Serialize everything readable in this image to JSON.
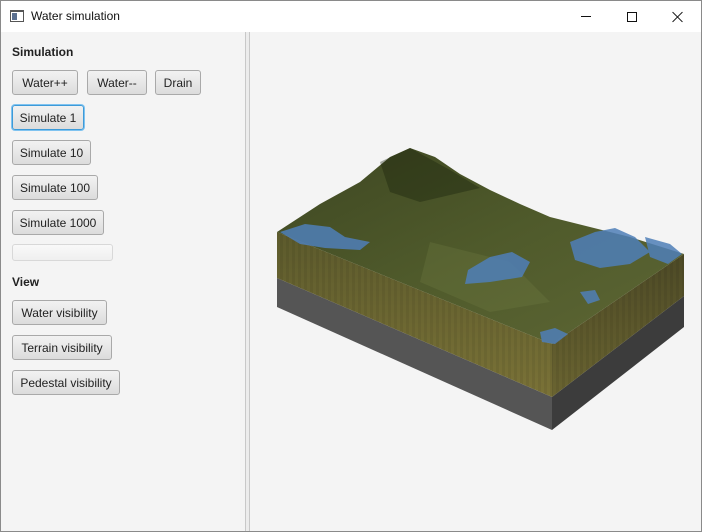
{
  "window": {
    "title": "Water simulation",
    "icon": "app-window-icon",
    "controls": {
      "minimize": "minimize-icon",
      "maximize": "maximize-icon",
      "close": "close-icon"
    }
  },
  "simulation": {
    "heading": "Simulation",
    "water_plus": "Water++",
    "water_minus": "Water--",
    "drain": "Drain",
    "simulate_1": "Simulate 1",
    "simulate_10": "Simulate 10",
    "simulate_100": "Simulate 100",
    "simulate_1000": "Simulate 1000",
    "progress": 0
  },
  "view": {
    "heading": "View",
    "water_visibility": "Water visibility",
    "terrain_visibility": "Terrain visibility",
    "pedestal_visibility": "Pedestal visibility"
  },
  "colors": {
    "terrain_top": "#4a5329",
    "terrain_side": "#6b6a33",
    "water": "#4f7fb8",
    "pedestal": "#4a4a4a",
    "focus_accent": "#3d9ad8"
  }
}
